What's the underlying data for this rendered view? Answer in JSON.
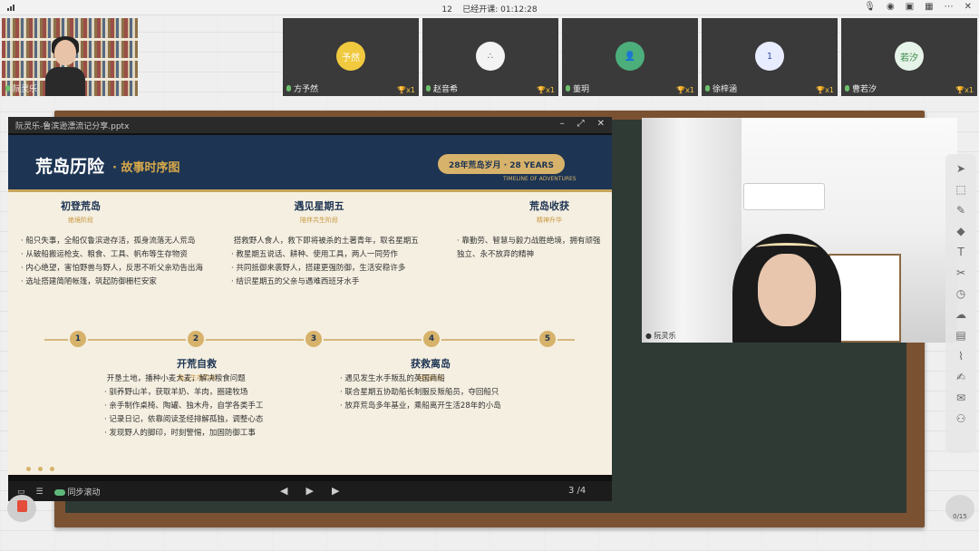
{
  "topbar": {
    "count": "12",
    "status": "已经开课: 01:12:28"
  },
  "participants": [
    {
      "name": "阮灵乐",
      "avatar_text": "",
      "color": "#c9b79d"
    },
    {
      "name": "方予然",
      "avatar_text": "予然",
      "color": "#f0c93f"
    },
    {
      "name": "赵音希",
      "avatar_text": "",
      "color": "#f3f3f3"
    },
    {
      "name": "董玥",
      "avatar_text": "",
      "color": "#4cae7b"
    },
    {
      "name": "徐梓涵",
      "avatar_text": "1",
      "color": "#e8ecff"
    },
    {
      "name": "曹若汐",
      "avatar_text": "若汐",
      "color": "#e6f3e8"
    }
  ],
  "trophy": "x1",
  "window": {
    "title": "阮灵乐-鲁滨逊漂流记分享.pptx"
  },
  "slide": {
    "title": "荒岛历险",
    "subtitle": "故事时序图",
    "pill": "28年荒岛岁月 · 28 YEARS",
    "pill_sub": "TIMELINE OF ADVENTURES",
    "top_stages": [
      {
        "title": "初登荒岛",
        "sub": "绝境阶段",
        "items": [
          "船只失事，全船仅鲁滨逊存活，孤身流落无人荒岛",
          "从破船搬运枪支、粮食、工具、帆布等生存物资",
          "内心绝望，害怕野兽与野人，反思不听父亲劝告出海",
          "选址搭建简陋帐篷，筑起防御栅栏安家"
        ]
      },
      {
        "title": "遇见星期五",
        "sub": "陪伴共生阶段",
        "items": [
          "搭救野人食人，救下即将被杀的土著青年，取名星期五",
          "教星期五说话、耕种、使用工具，两人一同劳作",
          "共同抵御来袭野人，搭建更强防御，生活安稳许多",
          "结识星期五的父亲与遇难西班牙水手"
        ]
      },
      {
        "title": "荒岛收获",
        "sub": "精神升华",
        "items": [
          "靠勤劳、智慧与毅力战胜绝境，拥有顽强独立、永不放弃的精神"
        ]
      }
    ],
    "bottom_stages": [
      {
        "title": "开荒自救",
        "sub": "独立生存阶段",
        "items": [
          "开垦土地，播种小麦大麦，解决粮食问题",
          "驯养野山羊，获取羊奶、羊肉，圈建牧场",
          "亲手制作桌椅、陶罐、独木舟，自学各类手工",
          "记录日记，依靠阅读圣经排解孤独，调整心态",
          "发现野人的脚印，时刻警惕，加固防御工事"
        ]
      },
      {
        "title": "获救离岛",
        "sub": "回归阶段",
        "items": [
          "遇见发生水手叛乱的英国商船",
          "联合星期五协助船长制服反叛船员，夺回船只",
          "放弃荒岛多年基业，乘船离开生活28年的小岛"
        ]
      }
    ],
    "nodes": [
      "1",
      "2",
      "3",
      "4",
      "5"
    ]
  },
  "controls": {
    "sync": "同步滚动",
    "page": "3 /4"
  },
  "camera": {
    "name": "阮灵乐"
  },
  "chat": {
    "count": "0/15"
  }
}
